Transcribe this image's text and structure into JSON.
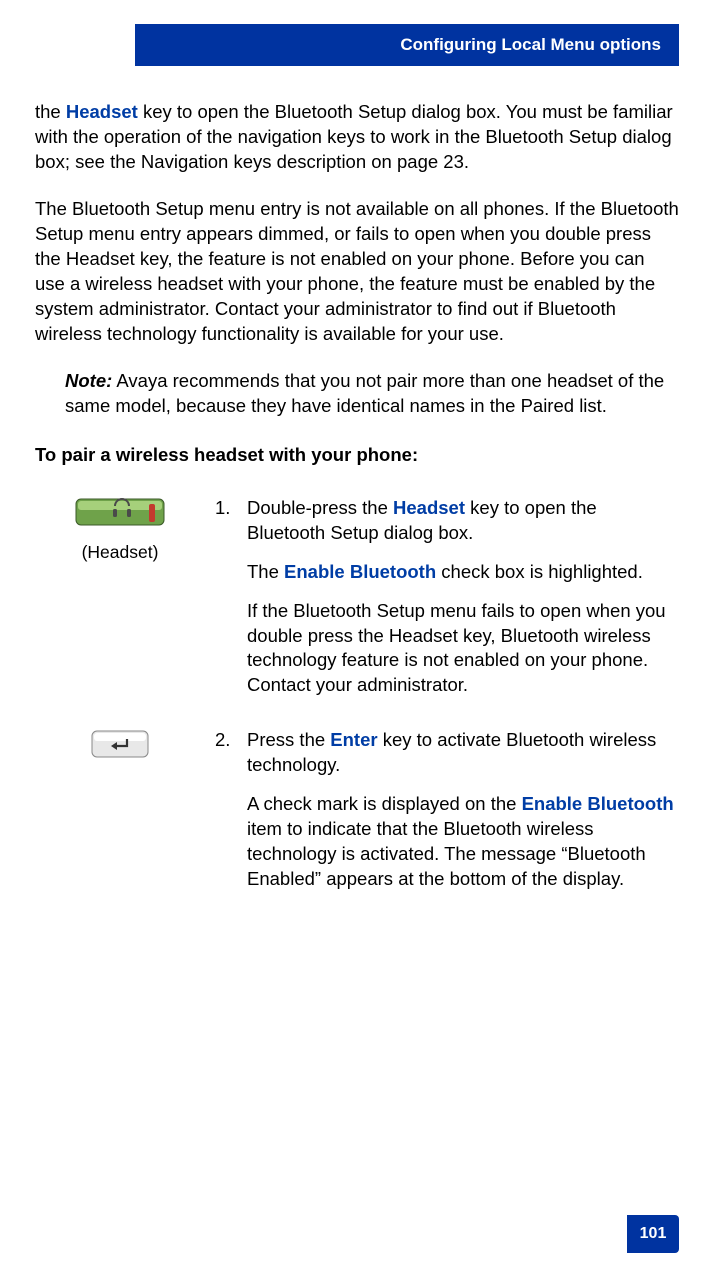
{
  "header": {
    "title": "Configuring Local Menu options"
  },
  "intro": {
    "p1a": "the ",
    "p1b": "Headset",
    "p1c": " key to open the Bluetooth Setup dialog box. You must be familiar with the operation of the navigation keys to work in the Bluetooth Setup dialog box; see the Navigation keys description on page 23."
  },
  "para2": "The Bluetooth Setup menu entry is not available on all phones. If the Bluetooth Setup menu entry appears dimmed, or fails to open when you double press the Headset key, the feature is not enabled on your phone. Before you can use a wireless headset with your phone, the feature must be enabled by the system administrator. Contact your administrator to find out if Bluetooth wireless technology functionality is available for your use.",
  "note": {
    "label": "Note:",
    "text": " Avaya recommends that you not pair more than one headset of the same model, because they have identical names in the Paired list."
  },
  "subhead": "To pair a wireless headset with your phone:",
  "steps": {
    "s1": {
      "caption": "(Headset)",
      "num": "1.",
      "line1a": "Double-press the ",
      "line1b": "Headset",
      "line1c": " key to open the Bluetooth Setup dialog box.",
      "sub1a": "The ",
      "sub1b": "Enable Bluetooth",
      "sub1c": " check box is highlighted.",
      "sub2": "If the Bluetooth Setup menu fails to open when you double press the Headset key, Bluetooth wireless technology feature is not enabled on your phone. Contact your administrator."
    },
    "s2": {
      "num": "2.",
      "line1a": "Press the ",
      "line1b": "Enter",
      "line1c": " key to activate Bluetooth wireless technology.",
      "sub1a": "A check mark is displayed on the ",
      "sub1b": "Enable Bluetooth",
      "sub1c": " item to indicate that the Bluetooth wireless technology is activated. The message “Bluetooth Enabled” appears at the bottom of the display."
    }
  },
  "page_number": "101"
}
